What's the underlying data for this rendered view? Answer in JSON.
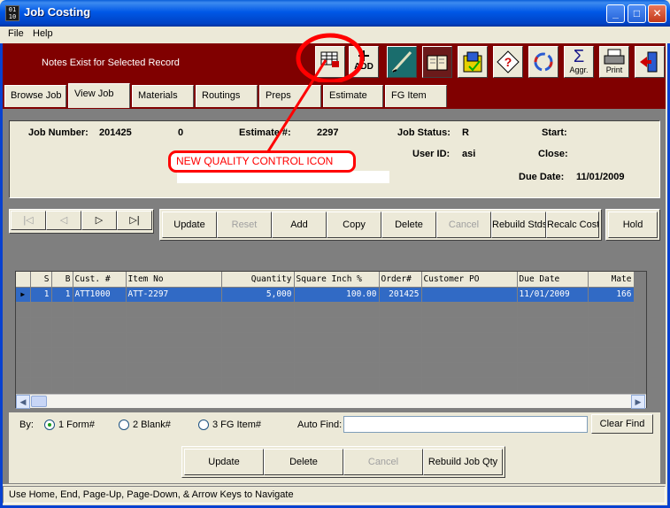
{
  "window": {
    "title": "Job Costing",
    "app_icon_text": "01 10"
  },
  "menu": [
    "File",
    "Help"
  ],
  "banner": {
    "notes": "Notes Exist for Selected Record"
  },
  "toolbar": {
    "icons": [
      {
        "name": "quality-control-icon",
        "label": ""
      },
      {
        "name": "add-icon",
        "label": "ADD"
      },
      {
        "name": "pen-icon",
        "label": ""
      },
      {
        "name": "book-icon",
        "label": ""
      },
      {
        "name": "box-icon",
        "label": ""
      },
      {
        "name": "help-icon",
        "label": ""
      },
      {
        "name": "refresh-icon",
        "label": ""
      },
      {
        "name": "aggregate-icon",
        "label": "Aggr."
      },
      {
        "name": "print-icon",
        "label": "Print"
      },
      {
        "name": "exit-icon",
        "label": ""
      }
    ]
  },
  "tabs": [
    "Browse Job",
    "View Job",
    "Materials",
    "Routings",
    "Preps",
    "Estimate",
    "FG Item"
  ],
  "info": {
    "job_number_label": "Job Number:",
    "job_number": "201425",
    "job_suffix": "0",
    "estimate_label": "Estimate #:",
    "estimate": "2297",
    "job_status_label": "Job Status:",
    "job_status": "R",
    "user_id_label": "User ID:",
    "user_id": "asi",
    "start_label": "Start:",
    "close_label": "Close:",
    "due_date_label": "Due Date:",
    "due_date": "11/01/2009"
  },
  "annotation": {
    "text": "NEW QUALITY CONTROL ICON",
    "color": "#ff0000"
  },
  "nav_buttons": [
    "|◁",
    "◁",
    "▷",
    "▷|"
  ],
  "action_buttons": [
    {
      "label": "Update",
      "enabled": true
    },
    {
      "label": "Reset",
      "enabled": false
    },
    {
      "label": "Add",
      "enabled": true
    },
    {
      "label": "Copy",
      "enabled": true
    },
    {
      "label": "Delete",
      "enabled": true
    },
    {
      "label": "Cancel",
      "enabled": false
    },
    {
      "label": "Rebuild Stds",
      "enabled": true
    },
    {
      "label": "Recalc Costs",
      "enabled": true
    }
  ],
  "hold_label": "Hold",
  "grid": {
    "columns": [
      "S",
      "B",
      "Cust. #",
      "Item No",
      "Quantity",
      "Square Inch %",
      "Order#",
      "Customer PO",
      "Due Date",
      "Mate"
    ],
    "rows": [
      [
        "1",
        "1",
        "ATT1000",
        "ATT-2297",
        "5,000",
        "100.00",
        "201425",
        "",
        "11/01/2009",
        "166"
      ]
    ]
  },
  "by": {
    "label": "By:",
    "options": [
      "1 Form#",
      "2 Blank#",
      "3 FG Item#"
    ],
    "selected": 0,
    "auto_find_label": "Auto Find:",
    "auto_find_value": "",
    "clear_find": "Clear Find"
  },
  "bottom_buttons": [
    {
      "label": "Update",
      "enabled": true
    },
    {
      "label": "Delete",
      "enabled": true
    },
    {
      "label": "Cancel",
      "enabled": false
    },
    {
      "label": "Rebuild Job Qty",
      "enabled": true
    }
  ],
  "status": "Use Home, End, Page-Up, Page-Down, & Arrow Keys to Navigate",
  "colors": {
    "banner": "#800000",
    "selection": "#316ac5",
    "titlebar": "#0058e6"
  }
}
